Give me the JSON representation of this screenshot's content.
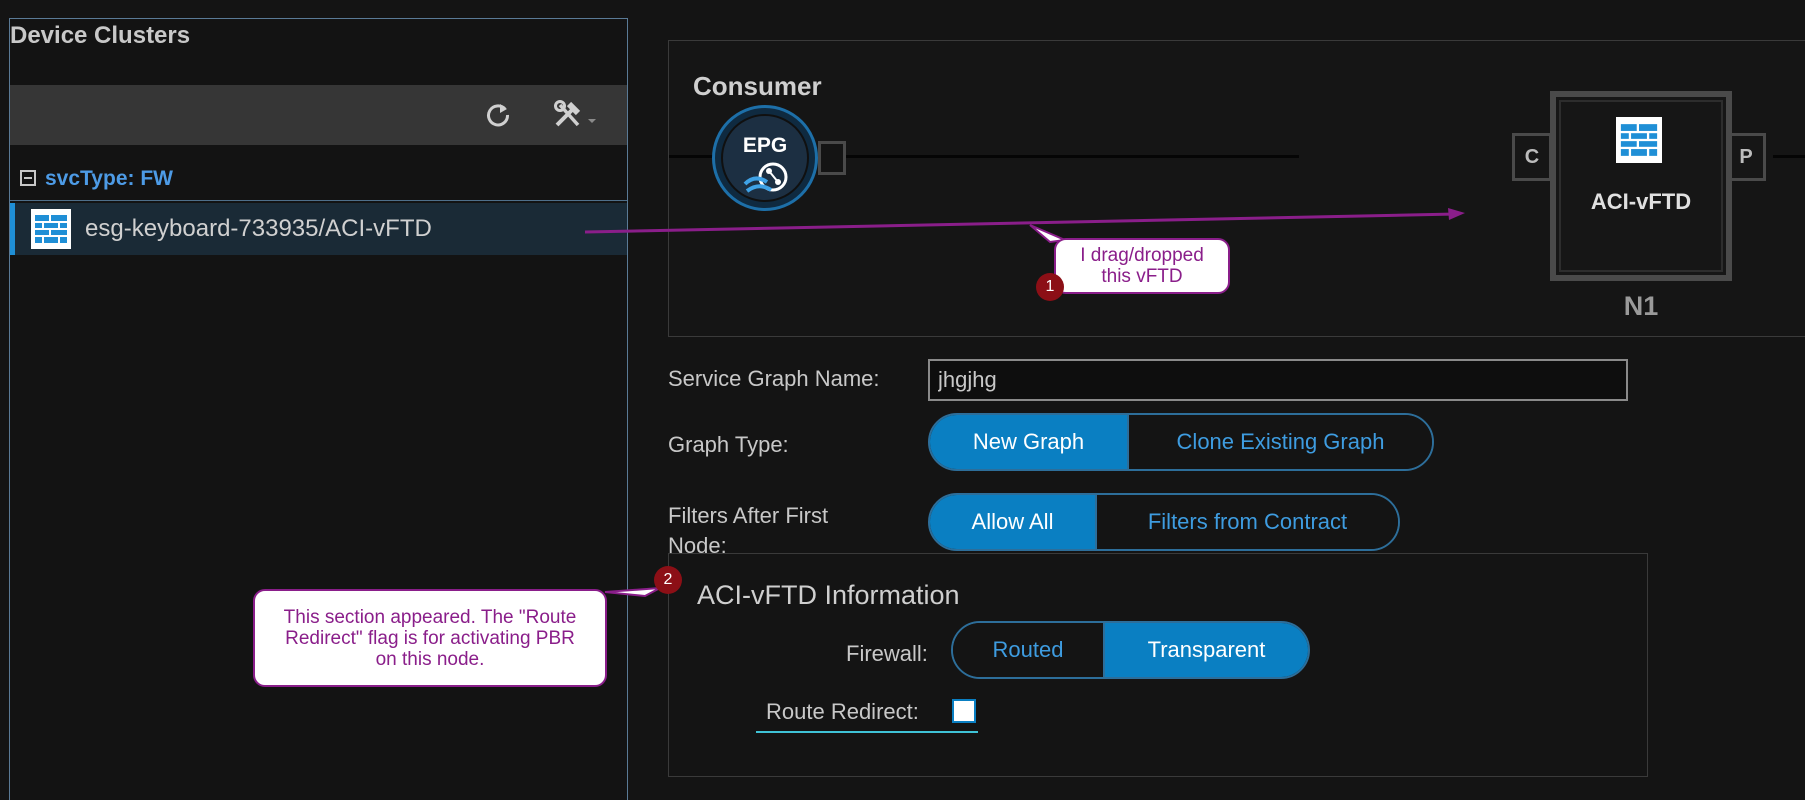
{
  "left_panel": {
    "title": "Device Clusters",
    "toolbar": {
      "refresh_icon": "refresh-icon",
      "tools_icon": "tools-icon"
    },
    "group_label": "svcType: FW",
    "cluster_item_label": "esg-keyboard-733935/ACI-vFTD"
  },
  "graph": {
    "consumer_title": "Consumer",
    "epg_label": "EPG",
    "node_label": "ACI-vFTD",
    "node_port_consumer": "C",
    "node_port_provider": "P",
    "node_name": "N1"
  },
  "form": {
    "service_graph_name_label": "Service Graph Name:",
    "service_graph_name_value": "jhgjhg",
    "graph_type_label": "Graph Type:",
    "graph_type_options": [
      "New Graph",
      "Clone Existing Graph"
    ],
    "graph_type_selected": "New Graph",
    "filters_label_line1": "Filters After First",
    "filters_label_line2": "Node:",
    "filters_options": [
      "Allow All",
      "Filters from Contract"
    ],
    "filters_selected": "Allow All"
  },
  "info_section": {
    "title": "ACI-vFTD Information",
    "firewall_label": "Firewall:",
    "firewall_options": [
      "Routed",
      "Transparent"
    ],
    "firewall_selected": "Transparent",
    "route_redirect_label": "Route Redirect:",
    "route_redirect_checked": false
  },
  "annotations": {
    "callout1_line1": "I drag/dropped",
    "callout1_line2": "this vFTD",
    "callout1_badge": "1",
    "callout2_line1": "This section appeared. The \"Route",
    "callout2_line2": "Redirect\" flag is for activating PBR",
    "callout2_line3": "on this node.",
    "callout2_badge": "2"
  },
  "colors": {
    "accent": "#0a7fc2",
    "link": "#3e9ce0",
    "annotation": "#8a1e8a",
    "badge": "#8c0f16"
  }
}
